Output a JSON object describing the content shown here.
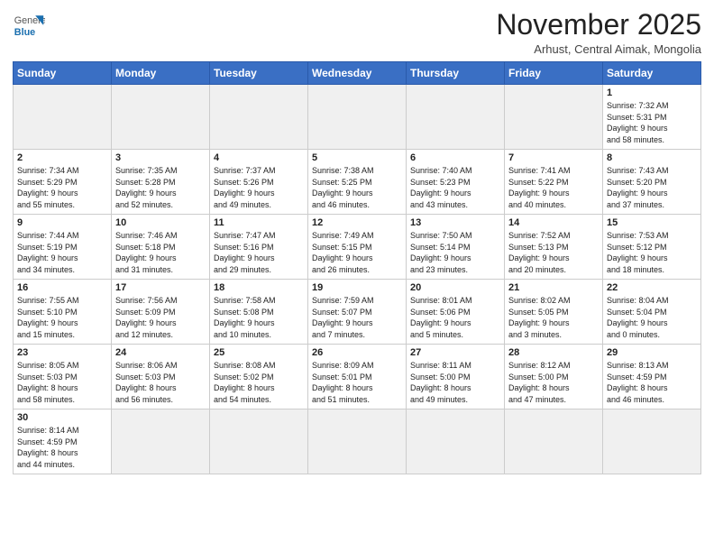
{
  "header": {
    "logo_general": "General",
    "logo_blue": "Blue",
    "month": "November 2025",
    "location": "Arhust, Central Aimak, Mongolia"
  },
  "weekdays": [
    "Sunday",
    "Monday",
    "Tuesday",
    "Wednesday",
    "Thursday",
    "Friday",
    "Saturday"
  ],
  "weeks": [
    [
      {
        "day": "",
        "info": ""
      },
      {
        "day": "",
        "info": ""
      },
      {
        "day": "",
        "info": ""
      },
      {
        "day": "",
        "info": ""
      },
      {
        "day": "",
        "info": ""
      },
      {
        "day": "",
        "info": ""
      },
      {
        "day": "1",
        "info": "Sunrise: 7:32 AM\nSunset: 5:31 PM\nDaylight: 9 hours\nand 58 minutes."
      }
    ],
    [
      {
        "day": "2",
        "info": "Sunrise: 7:34 AM\nSunset: 5:29 PM\nDaylight: 9 hours\nand 55 minutes."
      },
      {
        "day": "3",
        "info": "Sunrise: 7:35 AM\nSunset: 5:28 PM\nDaylight: 9 hours\nand 52 minutes."
      },
      {
        "day": "4",
        "info": "Sunrise: 7:37 AM\nSunset: 5:26 PM\nDaylight: 9 hours\nand 49 minutes."
      },
      {
        "day": "5",
        "info": "Sunrise: 7:38 AM\nSunset: 5:25 PM\nDaylight: 9 hours\nand 46 minutes."
      },
      {
        "day": "6",
        "info": "Sunrise: 7:40 AM\nSunset: 5:23 PM\nDaylight: 9 hours\nand 43 minutes."
      },
      {
        "day": "7",
        "info": "Sunrise: 7:41 AM\nSunset: 5:22 PM\nDaylight: 9 hours\nand 40 minutes."
      },
      {
        "day": "8",
        "info": "Sunrise: 7:43 AM\nSunset: 5:20 PM\nDaylight: 9 hours\nand 37 minutes."
      }
    ],
    [
      {
        "day": "9",
        "info": "Sunrise: 7:44 AM\nSunset: 5:19 PM\nDaylight: 9 hours\nand 34 minutes."
      },
      {
        "day": "10",
        "info": "Sunrise: 7:46 AM\nSunset: 5:18 PM\nDaylight: 9 hours\nand 31 minutes."
      },
      {
        "day": "11",
        "info": "Sunrise: 7:47 AM\nSunset: 5:16 PM\nDaylight: 9 hours\nand 29 minutes."
      },
      {
        "day": "12",
        "info": "Sunrise: 7:49 AM\nSunset: 5:15 PM\nDaylight: 9 hours\nand 26 minutes."
      },
      {
        "day": "13",
        "info": "Sunrise: 7:50 AM\nSunset: 5:14 PM\nDaylight: 9 hours\nand 23 minutes."
      },
      {
        "day": "14",
        "info": "Sunrise: 7:52 AM\nSunset: 5:13 PM\nDaylight: 9 hours\nand 20 minutes."
      },
      {
        "day": "15",
        "info": "Sunrise: 7:53 AM\nSunset: 5:12 PM\nDaylight: 9 hours\nand 18 minutes."
      }
    ],
    [
      {
        "day": "16",
        "info": "Sunrise: 7:55 AM\nSunset: 5:10 PM\nDaylight: 9 hours\nand 15 minutes."
      },
      {
        "day": "17",
        "info": "Sunrise: 7:56 AM\nSunset: 5:09 PM\nDaylight: 9 hours\nand 12 minutes."
      },
      {
        "day": "18",
        "info": "Sunrise: 7:58 AM\nSunset: 5:08 PM\nDaylight: 9 hours\nand 10 minutes."
      },
      {
        "day": "19",
        "info": "Sunrise: 7:59 AM\nSunset: 5:07 PM\nDaylight: 9 hours\nand 7 minutes."
      },
      {
        "day": "20",
        "info": "Sunrise: 8:01 AM\nSunset: 5:06 PM\nDaylight: 9 hours\nand 5 minutes."
      },
      {
        "day": "21",
        "info": "Sunrise: 8:02 AM\nSunset: 5:05 PM\nDaylight: 9 hours\nand 3 minutes."
      },
      {
        "day": "22",
        "info": "Sunrise: 8:04 AM\nSunset: 5:04 PM\nDaylight: 9 hours\nand 0 minutes."
      }
    ],
    [
      {
        "day": "23",
        "info": "Sunrise: 8:05 AM\nSunset: 5:03 PM\nDaylight: 8 hours\nand 58 minutes."
      },
      {
        "day": "24",
        "info": "Sunrise: 8:06 AM\nSunset: 5:03 PM\nDaylight: 8 hours\nand 56 minutes."
      },
      {
        "day": "25",
        "info": "Sunrise: 8:08 AM\nSunset: 5:02 PM\nDaylight: 8 hours\nand 54 minutes."
      },
      {
        "day": "26",
        "info": "Sunrise: 8:09 AM\nSunset: 5:01 PM\nDaylight: 8 hours\nand 51 minutes."
      },
      {
        "day": "27",
        "info": "Sunrise: 8:11 AM\nSunset: 5:00 PM\nDaylight: 8 hours\nand 49 minutes."
      },
      {
        "day": "28",
        "info": "Sunrise: 8:12 AM\nSunset: 5:00 PM\nDaylight: 8 hours\nand 47 minutes."
      },
      {
        "day": "29",
        "info": "Sunrise: 8:13 AM\nSunset: 4:59 PM\nDaylight: 8 hours\nand 46 minutes."
      }
    ],
    [
      {
        "day": "30",
        "info": "Sunrise: 8:14 AM\nSunset: 4:59 PM\nDaylight: 8 hours\nand 44 minutes."
      },
      {
        "day": "",
        "info": ""
      },
      {
        "day": "",
        "info": ""
      },
      {
        "day": "",
        "info": ""
      },
      {
        "day": "",
        "info": ""
      },
      {
        "day": "",
        "info": ""
      },
      {
        "day": "",
        "info": ""
      }
    ]
  ]
}
